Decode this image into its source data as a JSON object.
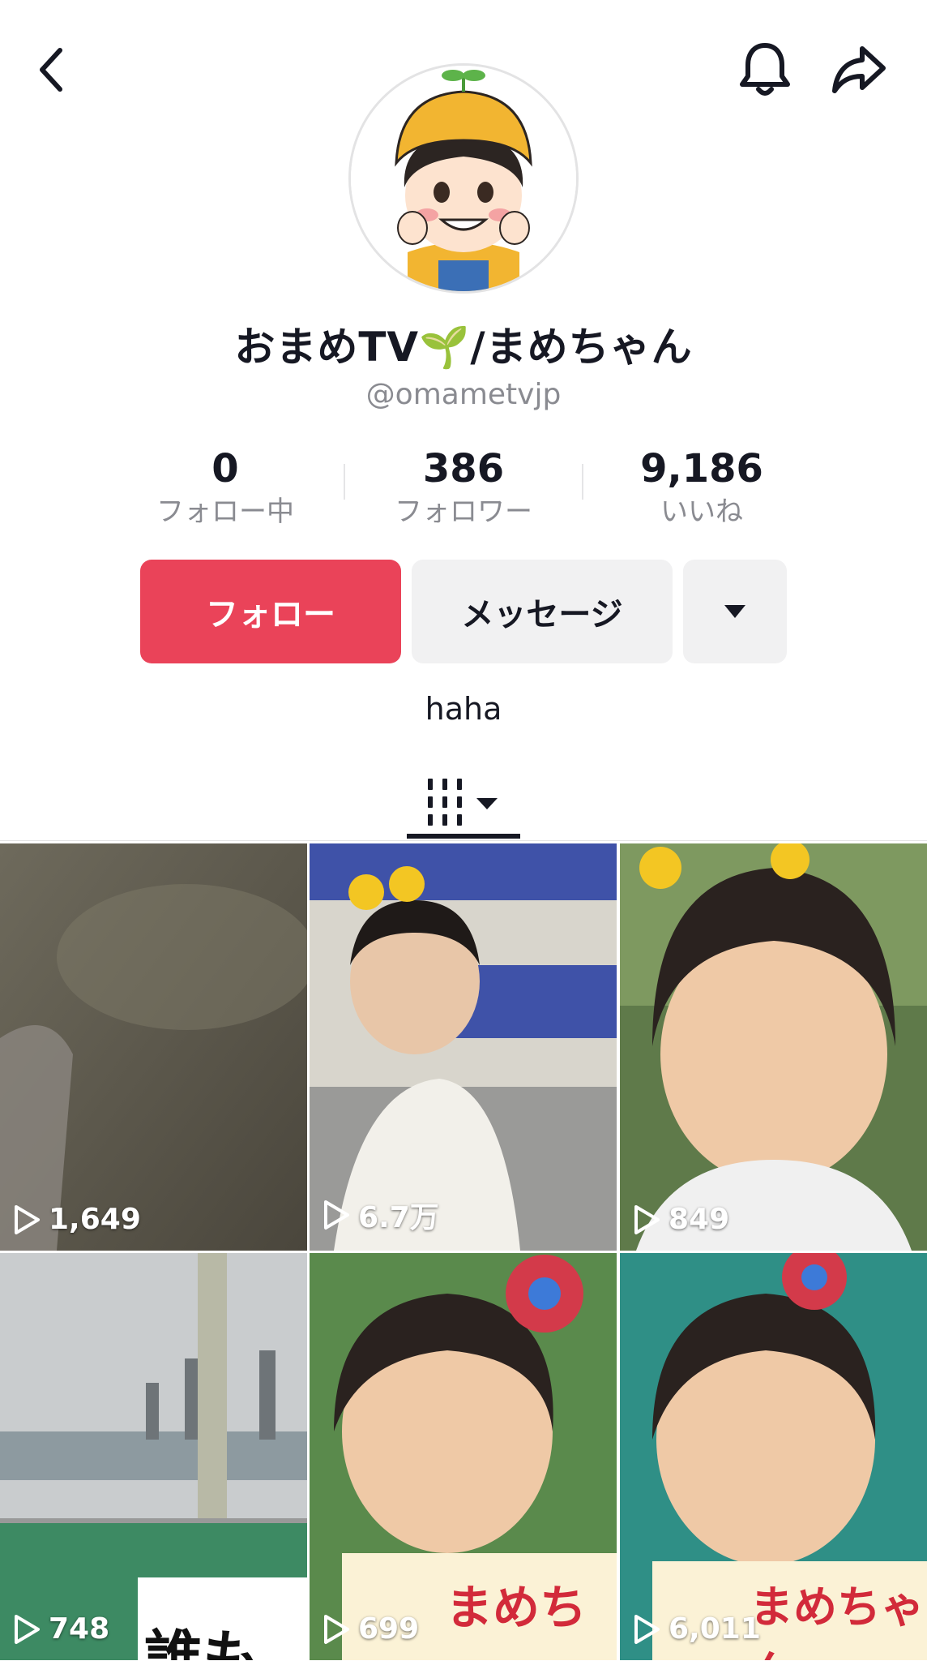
{
  "header": {
    "back_icon": "chevron-left-icon",
    "bell_icon": "bell-icon",
    "share_icon": "share-arrow-icon"
  },
  "profile": {
    "display_name": "おまめTV🌱/まめちゃん",
    "handle": "@omametvjp",
    "bio": "haha"
  },
  "stats": [
    {
      "value": "0",
      "label": "フォロー中"
    },
    {
      "value": "386",
      "label": "フォロワー"
    },
    {
      "value": "9,186",
      "label": "いいね"
    }
  ],
  "actions": {
    "follow_label": "フォロー",
    "message_label": "メッセージ",
    "more_icon": "caret-down-icon"
  },
  "colors": {
    "accent": "#ea4359",
    "secondary_button": "#f1f1f2",
    "text": "#161823",
    "muted": "#8a8b91"
  },
  "videos": [
    {
      "views": "1,649"
    },
    {
      "views": "6.7万"
    },
    {
      "views": "849"
    },
    {
      "views": "748",
      "overlay_text": "誰も"
    },
    {
      "views": "699",
      "overlay_text": "まめち"
    },
    {
      "views": "6,011",
      "overlay_text": "まめちゃん"
    }
  ]
}
